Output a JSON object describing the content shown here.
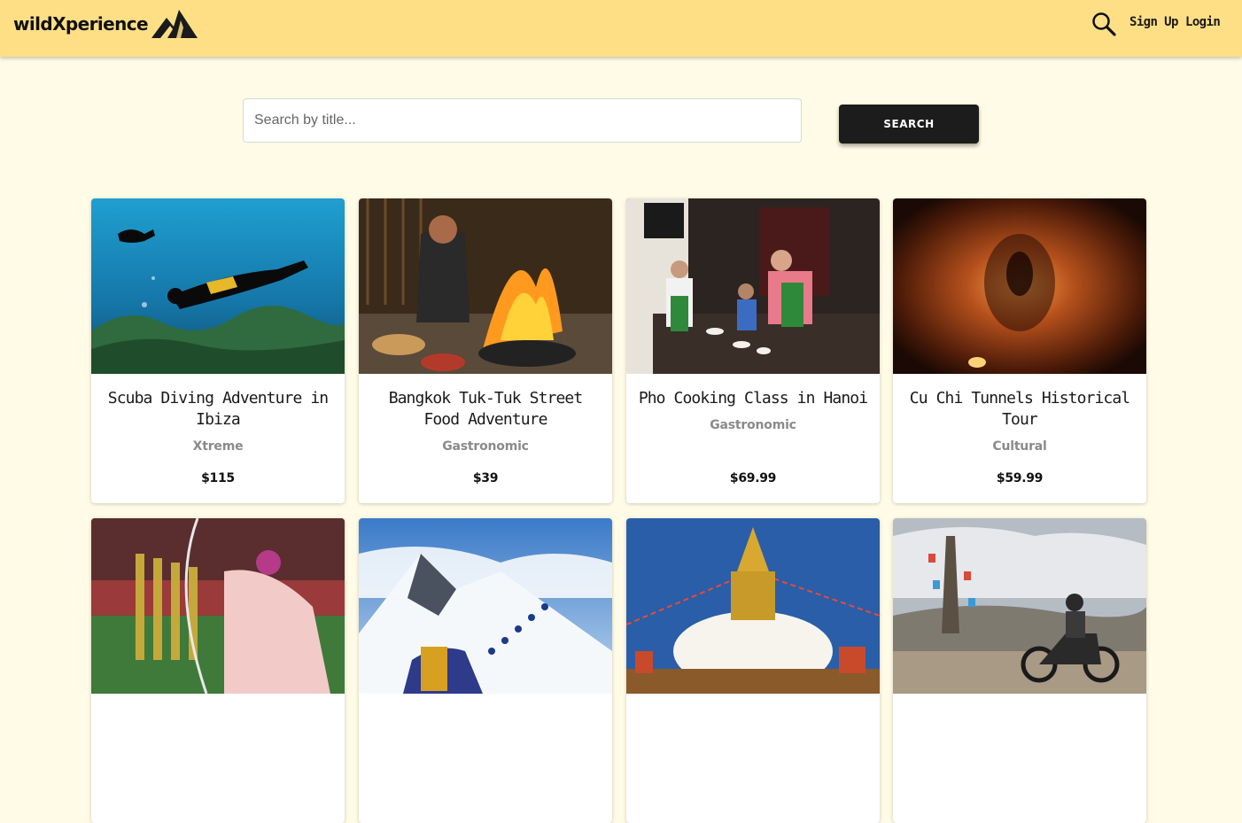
{
  "header": {
    "logo_text": "wildXperience",
    "nav": {
      "signup": "Sign Up",
      "login": "Login"
    }
  },
  "search": {
    "placeholder": "Search by title...",
    "button_label": "SEARCH"
  },
  "experiences": [
    {
      "title": "Scuba Diving Adventure in Ibiza",
      "category": "Xtreme",
      "price": "$115"
    },
    {
      "title": "Bangkok Tuk-Tuk Street Food Adventure",
      "category": "Gastronomic",
      "price": "$39"
    },
    {
      "title": "Pho Cooking Class in Hanoi",
      "category": "Gastronomic",
      "price": "$69.99"
    },
    {
      "title": "Cu Chi Tunnels Historical Tour",
      "category": "Cultural",
      "price": "$59.99"
    }
  ],
  "colors": {
    "header_bg": "#ffdf86",
    "page_bg": "#fffbe6",
    "button_bg": "#1c1c1c",
    "category_text": "#8a8a8a"
  }
}
